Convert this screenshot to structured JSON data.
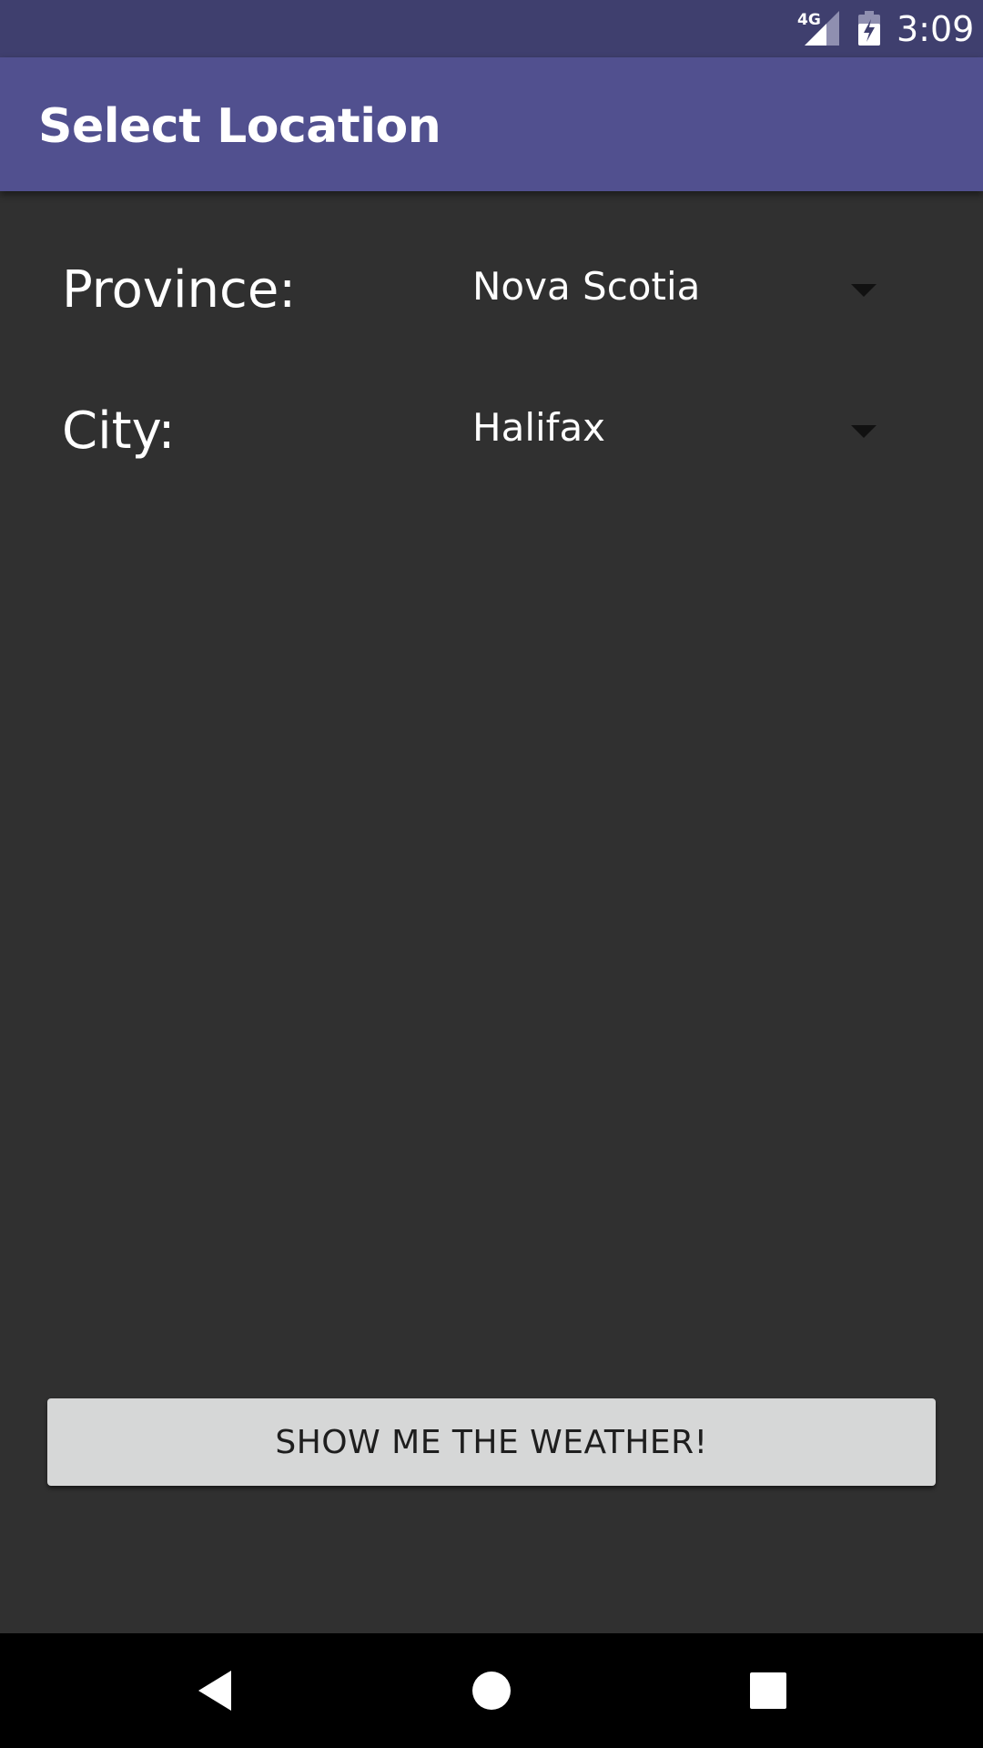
{
  "status_bar": {
    "network_label": "4G",
    "time": "3:09",
    "icons": [
      "signal-icon",
      "battery-charging-icon"
    ]
  },
  "app_bar": {
    "title": "Select Location"
  },
  "form": {
    "province": {
      "label": "Province:",
      "selected": "Nova Scotia"
    },
    "city": {
      "label": "City:",
      "selected": "Halifax"
    }
  },
  "action": {
    "button_label": "SHOW ME THE WEATHER!"
  },
  "nav_bar": {
    "icons": [
      "back-icon",
      "home-icon",
      "recents-icon"
    ]
  },
  "colors": {
    "status_bar": "#3f3f6e",
    "app_bar": "#51508f",
    "background": "#303030",
    "button": "#d6d7d7",
    "nav_bar": "#000000"
  }
}
